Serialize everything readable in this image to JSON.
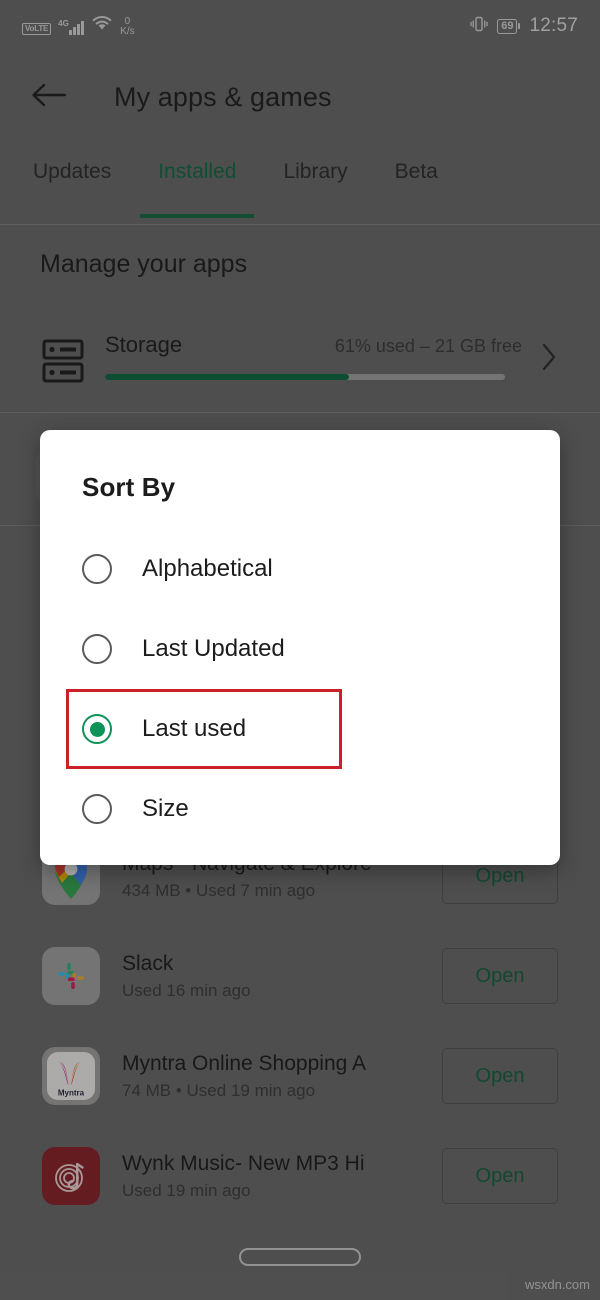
{
  "status_bar": {
    "volte_label": "VoLTE",
    "network_type": "4G",
    "data_rate_value": "0",
    "data_rate_unit": "K/s",
    "battery_level": "69",
    "time": "12:57",
    "icons": {
      "wifi": "wifi-icon",
      "signal": "signal-bars-icon",
      "vibrate": "vibrate-icon",
      "battery": "battery-icon"
    }
  },
  "header": {
    "back_label": "back-arrow-icon",
    "title": "My apps & games"
  },
  "tabs": [
    {
      "label": "Updates",
      "active": false
    },
    {
      "label": "Installed",
      "active": true
    },
    {
      "label": "Library",
      "active": false
    },
    {
      "label": "Beta",
      "active": false
    }
  ],
  "manage": {
    "section_title": "Manage your apps",
    "storage": {
      "label": "Storage",
      "usage_text": "61% used – 21 GB free",
      "percent_used": 61,
      "chevron": "chevron-right-icon"
    }
  },
  "dialog": {
    "title": "Sort By",
    "selected": "Last used",
    "options": [
      {
        "label": "Alphabetical",
        "selected": false,
        "highlighted": false
      },
      {
        "label": "Last Updated",
        "selected": false,
        "highlighted": false
      },
      {
        "label": "Last used",
        "selected": true,
        "highlighted": true
      },
      {
        "label": "Size",
        "selected": false,
        "highlighted": false
      }
    ]
  },
  "app_list": [
    {
      "name": "Maps - Navigate & Explore",
      "meta": "434 MB • Used 7 min ago",
      "action_label": "Open",
      "icon": "google-maps-icon"
    },
    {
      "name": "Slack",
      "meta": "Used 16 min ago",
      "action_label": "Open",
      "icon": "slack-icon"
    },
    {
      "name": "Myntra Online Shopping A",
      "meta": "74 MB • Used 19 min ago",
      "action_label": "Open",
      "icon": "myntra-icon"
    },
    {
      "name": "Wynk Music- New MP3 Hi",
      "meta": "Used 19 min ago",
      "action_label": "Open",
      "icon": "wynk-music-icon"
    }
  ],
  "footer": {
    "watermark": "wsxdn.com"
  },
  "colors": {
    "accent_green": "#0f6b44",
    "radio_green": "#0d9257",
    "annotation_red": "#cc2027",
    "scrim": "#6b6b6b"
  }
}
